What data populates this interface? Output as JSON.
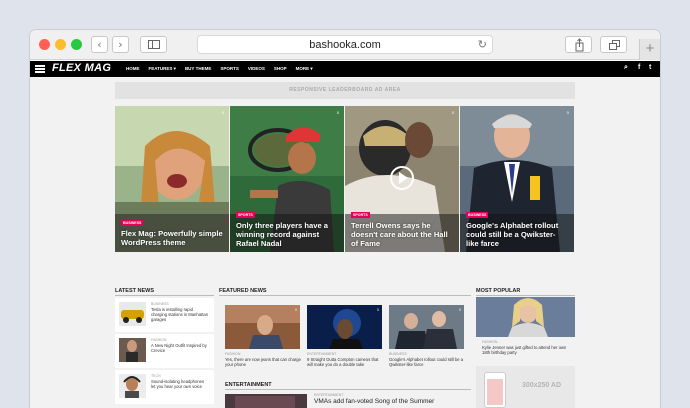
{
  "browser": {
    "url": "bashooka.com",
    "back_icon": "‹",
    "forward_icon": "›",
    "reload_icon": "↻",
    "new_tab_icon": "+"
  },
  "site": {
    "logo": "FLEX MAG",
    "menu": [
      "HOME",
      "FEATURES ▾",
      "BUY THEME",
      "SPORTS",
      "VIDEOS",
      "SHOP",
      "MORE ▾"
    ],
    "icons": {
      "search": "⌕",
      "facebook": "f",
      "twitter": "t"
    }
  },
  "ad_leaderboard": "RESPONSIVE LEADERBOARD AD AREA",
  "heroes": [
    {
      "tag": "BUSINESS",
      "title": "Flex Mag: Powerfully simple WordPress theme",
      "meta": "0"
    },
    {
      "tag": "SPORTS",
      "title": "Only three players have a winning record against Rafael Nadal",
      "meta": "0"
    },
    {
      "tag": "SPORTS",
      "title": "Terrell Owens says he doesn't care about the Hall of Fame",
      "meta": "0"
    },
    {
      "tag": "BUSINESS",
      "title": "Google's Alphabet rollout could still be a Qwikster-like farce",
      "meta": "0"
    }
  ],
  "sections": {
    "latest": "LATEST NEWS",
    "featured": "FEATURED NEWS",
    "popular": "MOST POPULAR",
    "entertainment": "ENTERTAINMENT"
  },
  "latest_news": [
    {
      "cat": "BUSINESS",
      "text": "Tesla is installing rapid charging stations in Manhattan garages"
    },
    {
      "cat": "FASHION",
      "text": "A New Night Outfit Inspired by Crevice"
    },
    {
      "cat": "TECH",
      "text": "Sound-isolating headphones let you hear your own voice"
    }
  ],
  "featured_news": [
    {
      "cat": "FASHION",
      "text": "Yes, there are now jeans that can charge your phone",
      "meta": "0"
    },
    {
      "cat": "ENTERTAINMENT",
      "text": "9 Straight Outta Compton cameos that will make you do a double take",
      "meta": "0"
    },
    {
      "cat": "BUSINESS",
      "text": "Google's Alphabet rollout could still be a Qwikster-like farce",
      "meta": "0"
    }
  ],
  "popular": {
    "cat": "FASHION",
    "text": "Kylie Jenner was just gifted to attend her own 18th birthday party"
  },
  "ad_box": "300x250 AD",
  "entertainment": {
    "cat": "ENTERTAINMENT",
    "text": "VMAs add fan-voted Song of the Summer"
  }
}
